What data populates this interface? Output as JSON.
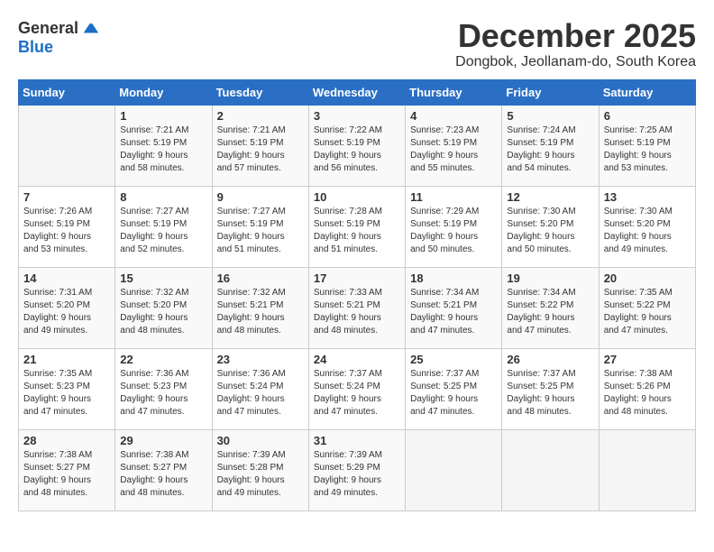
{
  "header": {
    "logo_general": "General",
    "logo_blue": "Blue",
    "month_title": "December 2025",
    "subtitle": "Dongbok, Jeollanam-do, South Korea"
  },
  "weekdays": [
    "Sunday",
    "Monday",
    "Tuesday",
    "Wednesday",
    "Thursday",
    "Friday",
    "Saturday"
  ],
  "weeks": [
    [
      {
        "day": "",
        "content": ""
      },
      {
        "day": "1",
        "content": "Sunrise: 7:21 AM\nSunset: 5:19 PM\nDaylight: 9 hours\nand 58 minutes."
      },
      {
        "day": "2",
        "content": "Sunrise: 7:21 AM\nSunset: 5:19 PM\nDaylight: 9 hours\nand 57 minutes."
      },
      {
        "day": "3",
        "content": "Sunrise: 7:22 AM\nSunset: 5:19 PM\nDaylight: 9 hours\nand 56 minutes."
      },
      {
        "day": "4",
        "content": "Sunrise: 7:23 AM\nSunset: 5:19 PM\nDaylight: 9 hours\nand 55 minutes."
      },
      {
        "day": "5",
        "content": "Sunrise: 7:24 AM\nSunset: 5:19 PM\nDaylight: 9 hours\nand 54 minutes."
      },
      {
        "day": "6",
        "content": "Sunrise: 7:25 AM\nSunset: 5:19 PM\nDaylight: 9 hours\nand 53 minutes."
      }
    ],
    [
      {
        "day": "7",
        "content": "Sunrise: 7:26 AM\nSunset: 5:19 PM\nDaylight: 9 hours\nand 53 minutes."
      },
      {
        "day": "8",
        "content": "Sunrise: 7:27 AM\nSunset: 5:19 PM\nDaylight: 9 hours\nand 52 minutes."
      },
      {
        "day": "9",
        "content": "Sunrise: 7:27 AM\nSunset: 5:19 PM\nDaylight: 9 hours\nand 51 minutes."
      },
      {
        "day": "10",
        "content": "Sunrise: 7:28 AM\nSunset: 5:19 PM\nDaylight: 9 hours\nand 51 minutes."
      },
      {
        "day": "11",
        "content": "Sunrise: 7:29 AM\nSunset: 5:19 PM\nDaylight: 9 hours\nand 50 minutes."
      },
      {
        "day": "12",
        "content": "Sunrise: 7:30 AM\nSunset: 5:20 PM\nDaylight: 9 hours\nand 50 minutes."
      },
      {
        "day": "13",
        "content": "Sunrise: 7:30 AM\nSunset: 5:20 PM\nDaylight: 9 hours\nand 49 minutes."
      }
    ],
    [
      {
        "day": "14",
        "content": "Sunrise: 7:31 AM\nSunset: 5:20 PM\nDaylight: 9 hours\nand 49 minutes."
      },
      {
        "day": "15",
        "content": "Sunrise: 7:32 AM\nSunset: 5:20 PM\nDaylight: 9 hours\nand 48 minutes."
      },
      {
        "day": "16",
        "content": "Sunrise: 7:32 AM\nSunset: 5:21 PM\nDaylight: 9 hours\nand 48 minutes."
      },
      {
        "day": "17",
        "content": "Sunrise: 7:33 AM\nSunset: 5:21 PM\nDaylight: 9 hours\nand 48 minutes."
      },
      {
        "day": "18",
        "content": "Sunrise: 7:34 AM\nSunset: 5:21 PM\nDaylight: 9 hours\nand 47 minutes."
      },
      {
        "day": "19",
        "content": "Sunrise: 7:34 AM\nSunset: 5:22 PM\nDaylight: 9 hours\nand 47 minutes."
      },
      {
        "day": "20",
        "content": "Sunrise: 7:35 AM\nSunset: 5:22 PM\nDaylight: 9 hours\nand 47 minutes."
      }
    ],
    [
      {
        "day": "21",
        "content": "Sunrise: 7:35 AM\nSunset: 5:23 PM\nDaylight: 9 hours\nand 47 minutes."
      },
      {
        "day": "22",
        "content": "Sunrise: 7:36 AM\nSunset: 5:23 PM\nDaylight: 9 hours\nand 47 minutes."
      },
      {
        "day": "23",
        "content": "Sunrise: 7:36 AM\nSunset: 5:24 PM\nDaylight: 9 hours\nand 47 minutes."
      },
      {
        "day": "24",
        "content": "Sunrise: 7:37 AM\nSunset: 5:24 PM\nDaylight: 9 hours\nand 47 minutes."
      },
      {
        "day": "25",
        "content": "Sunrise: 7:37 AM\nSunset: 5:25 PM\nDaylight: 9 hours\nand 47 minutes."
      },
      {
        "day": "26",
        "content": "Sunrise: 7:37 AM\nSunset: 5:25 PM\nDaylight: 9 hours\nand 48 minutes."
      },
      {
        "day": "27",
        "content": "Sunrise: 7:38 AM\nSunset: 5:26 PM\nDaylight: 9 hours\nand 48 minutes."
      }
    ],
    [
      {
        "day": "28",
        "content": "Sunrise: 7:38 AM\nSunset: 5:27 PM\nDaylight: 9 hours\nand 48 minutes."
      },
      {
        "day": "29",
        "content": "Sunrise: 7:38 AM\nSunset: 5:27 PM\nDaylight: 9 hours\nand 48 minutes."
      },
      {
        "day": "30",
        "content": "Sunrise: 7:39 AM\nSunset: 5:28 PM\nDaylight: 9 hours\nand 49 minutes."
      },
      {
        "day": "31",
        "content": "Sunrise: 7:39 AM\nSunset: 5:29 PM\nDaylight: 9 hours\nand 49 minutes."
      },
      {
        "day": "",
        "content": ""
      },
      {
        "day": "",
        "content": ""
      },
      {
        "day": "",
        "content": ""
      }
    ]
  ]
}
